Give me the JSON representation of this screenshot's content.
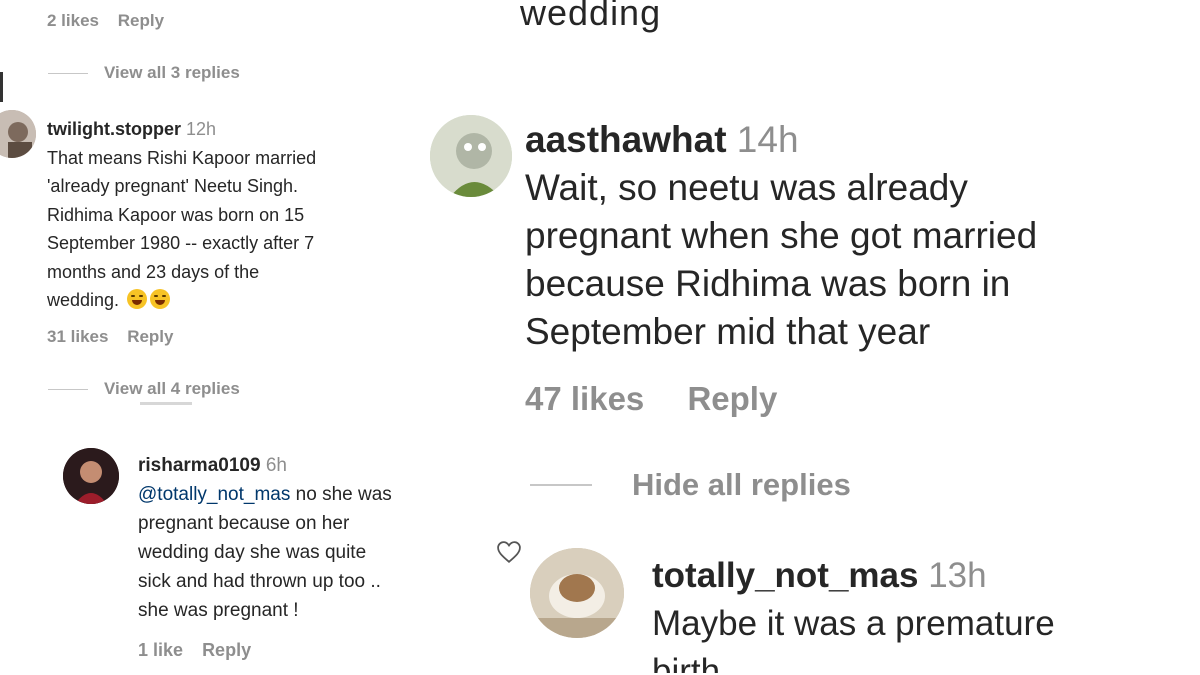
{
  "left": {
    "top_meta": {
      "likes": "2 likes",
      "reply": "Reply"
    },
    "view_replies_1": "View all 3 replies",
    "comment1": {
      "username": "twilight.stopper",
      "time": "12h",
      "lines": [
        "That means Rishi Kapoor married",
        "'already pregnant' Neetu Singh.",
        "Ridhima Kapoor was born on 15",
        "September 1980 -- exactly after 7",
        "months and 23 days of the",
        "wedding."
      ],
      "emoji_icon": "joy-emoji-icon",
      "likes": "31 likes",
      "reply": "Reply"
    },
    "view_replies_2": "View all 4 replies",
    "comment2": {
      "username": "risharma0109",
      "time": "6h",
      "mention": "@totally_not_mas",
      "line1_rest": "no she was",
      "lines": [
        "pregnant because on her",
        "wedding day she was quite",
        "sick and had thrown up too ..",
        "she was pregnant !"
      ],
      "likes": "1 like",
      "reply": "Reply"
    }
  },
  "right": {
    "top_partial": "wedding",
    "comment1": {
      "username": "aasthawhat",
      "time": "14h",
      "lines": [
        "Wait, so neetu was already",
        "pregnant when she got married",
        "because Ridhima was born in",
        "September mid that year"
      ],
      "likes": "47 likes",
      "reply": "Reply"
    },
    "hide_replies": "Hide all replies",
    "comment2": {
      "username": "totally_not_mas",
      "time": "13h",
      "lines": [
        "Maybe it was a premature",
        "birth"
      ]
    }
  },
  "icons": {
    "like": "heart-outline-icon"
  }
}
